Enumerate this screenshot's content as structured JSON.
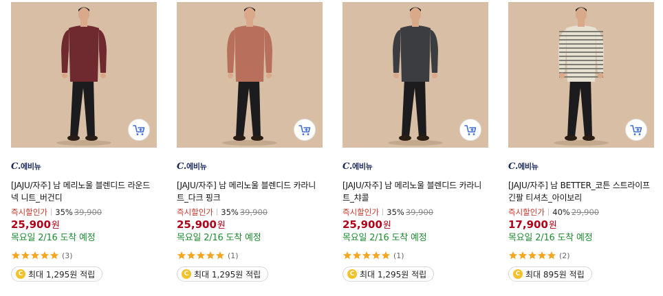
{
  "products": [
    {
      "brand_mark": "C.",
      "brand_name": "에비뉴",
      "name": "[JAJU/자주] 남 메리노울 블렌디드 라운드넥 니트_버건디",
      "promo_label": "즉시할인가",
      "discount_rate": "35%",
      "original_price": "39,900",
      "price": "25,900",
      "currency": "원",
      "delivery": "목요일 2/16 도착 예정",
      "rating_stars": 5,
      "review_count": "(3)",
      "points_text": "최대 1,295원 적립",
      "sweater_color": "#6e2a2f",
      "icon": "add-to-cart-icon"
    },
    {
      "brand_mark": "C.",
      "brand_name": "에비뉴",
      "name": "[JAJU/자주] 남 메리노울 블렌디드 카라니트_다크 핑크",
      "promo_label": "즉시할인가",
      "discount_rate": "35%",
      "original_price": "39,900",
      "price": "25,900",
      "currency": "원",
      "delivery": "목요일 2/16 도착 예정",
      "rating_stars": 5,
      "review_count": "(1)",
      "points_text": "최대 1,295원 적립",
      "sweater_color": "#b8705c",
      "icon": "add-to-cart-icon"
    },
    {
      "brand_mark": "C.",
      "brand_name": "에비뉴",
      "name": "[JAJU/자주] 남 메리노울 블렌디드 카라니트_챠콜",
      "promo_label": "즉시할인가",
      "discount_rate": "35%",
      "original_price": "39,900",
      "price": "25,900",
      "currency": "원",
      "delivery": "목요일 2/16 도착 예정",
      "rating_stars": 5,
      "review_count": "(1)",
      "points_text": "최대 1,295원 적립",
      "sweater_color": "#3c3d40",
      "icon": "add-to-cart-icon"
    },
    {
      "brand_mark": "C.",
      "brand_name": "에비뉴",
      "name": "[JAJU/자주] 남 BETTER_코튼 스트라이프 긴팔 티셔츠_아이보리",
      "promo_label": "즉시할인가",
      "discount_rate": "40%",
      "original_price": "29,900",
      "price": "17,900",
      "currency": "원",
      "delivery": "목요일 2/16 도착 예정",
      "rating_stars": 5,
      "review_count": "(2)",
      "points_text": "최대 895원 적립",
      "sweater_color": "#e6e1d3",
      "icon": "add-to-cart-icon"
    }
  ],
  "colors": {
    "price": "#b00018",
    "delivery": "#1e8a31",
    "star": "#f5a623",
    "coin": "#f3c12a",
    "brand": "#1b2a5a"
  }
}
